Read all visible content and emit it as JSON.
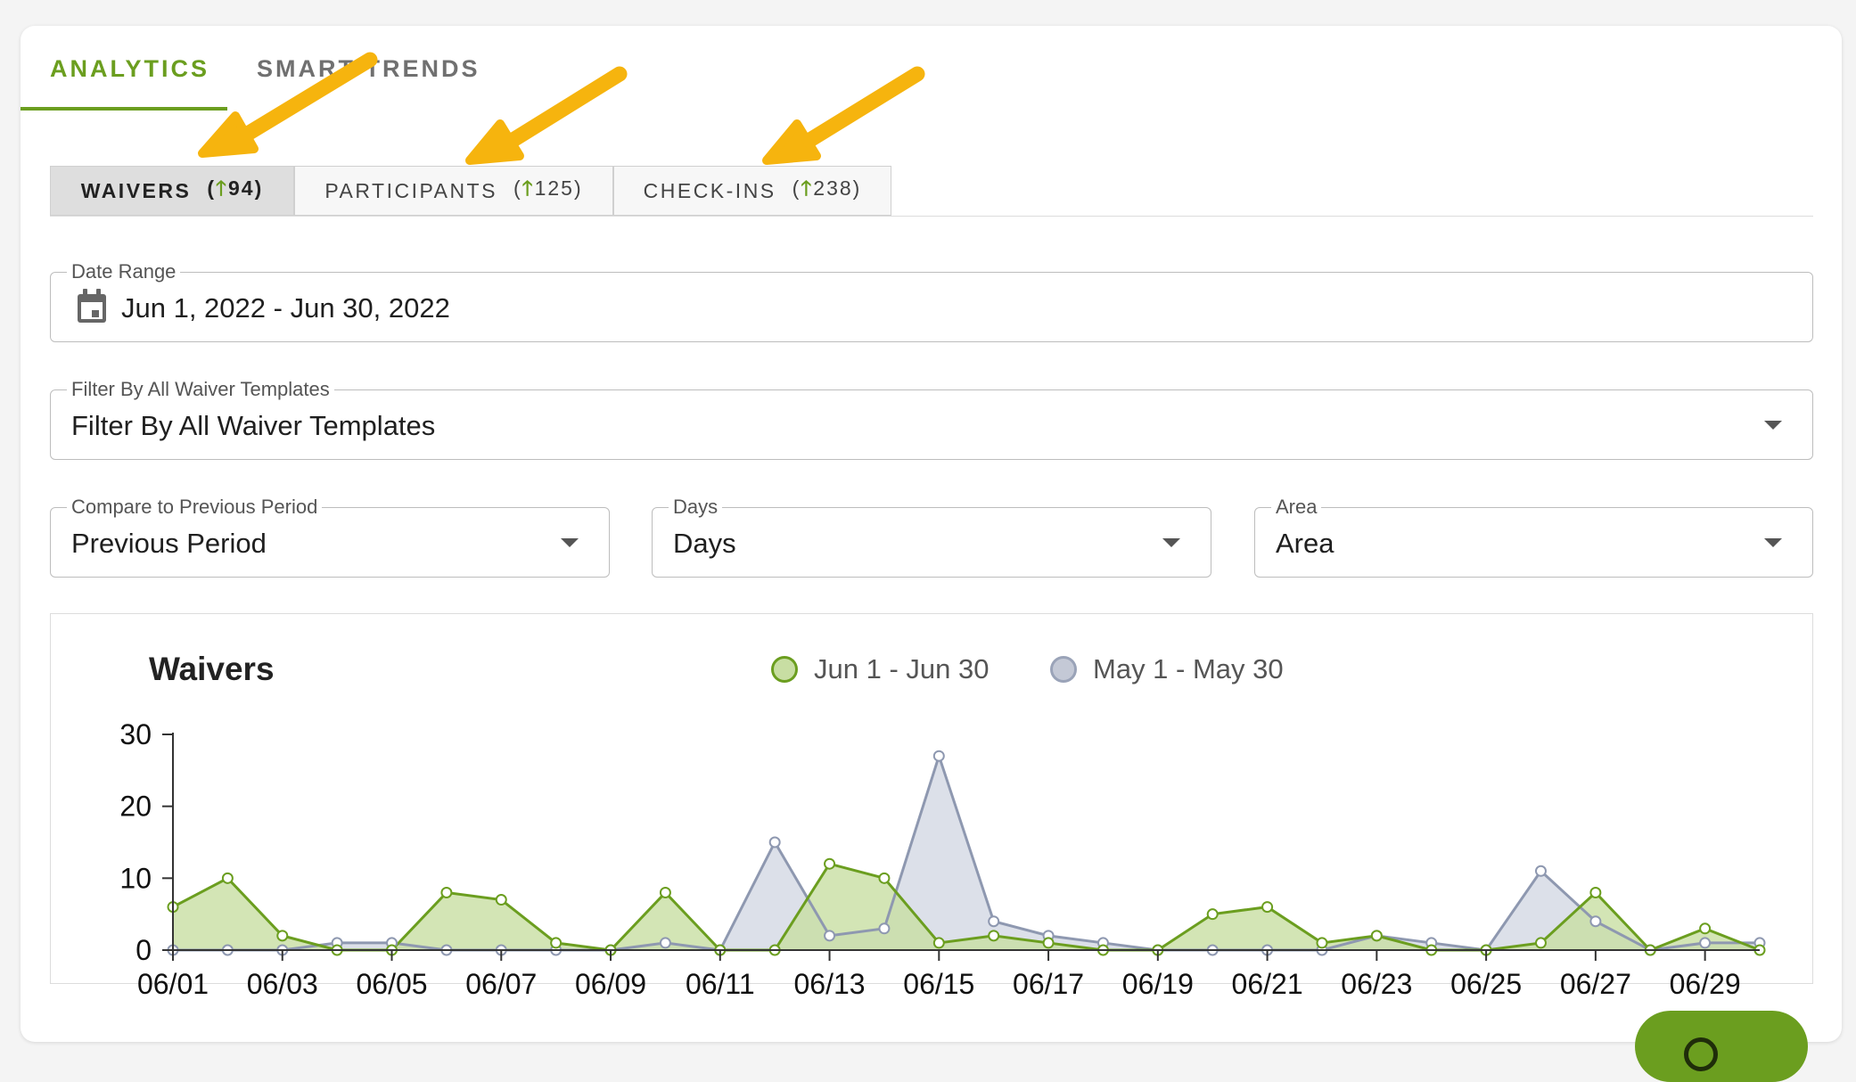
{
  "tabs": [
    {
      "label": "ANALYTICS",
      "active": true
    },
    {
      "label": "SMART TRENDS",
      "active": false
    }
  ],
  "sub_tabs": [
    {
      "label": "WAIVERS",
      "count": "94",
      "active": true
    },
    {
      "label": "PARTICIPANTS",
      "count": "125",
      "active": false
    },
    {
      "label": "CHECK-INS",
      "count": "238",
      "active": false
    }
  ],
  "icons": {
    "trend": "arrow-up-icon",
    "calendar": "calendar-icon",
    "dropdown": "caret-down-icon",
    "help": "help-icon"
  },
  "filters": {
    "date_range": {
      "label": "Date Range",
      "value": "Jun 1, 2022 - Jun 30, 2022"
    },
    "template": {
      "label": "Filter By All Waiver Templates",
      "value": "Filter By All Waiver Templates"
    },
    "compare": {
      "label": "Compare to Previous Period",
      "value": "Previous Period"
    },
    "interval": {
      "label": "Days",
      "value": "Days"
    },
    "chart_type": {
      "label": "Area",
      "value": "Area"
    }
  },
  "colors": {
    "accent": "#6b9e1f",
    "current_fill": "#c8dea3",
    "previous_line": "#8e98b0",
    "previous_fill": "#d3d8e3",
    "annotation_arrow": "#f6b40e"
  },
  "chart_data": {
    "type": "area",
    "title": "Waivers",
    "x": [
      "06/01",
      "06/02",
      "06/03",
      "06/04",
      "06/05",
      "06/06",
      "06/07",
      "06/08",
      "06/09",
      "06/10",
      "06/11",
      "06/12",
      "06/13",
      "06/14",
      "06/15",
      "06/16",
      "06/17",
      "06/18",
      "06/19",
      "06/20",
      "06/21",
      "06/22",
      "06/23",
      "06/24",
      "06/25",
      "06/26",
      "06/27",
      "06/28",
      "06/29",
      "06/30"
    ],
    "x_tick_labels": [
      "06/01",
      "06/03",
      "06/05",
      "06/07",
      "06/09",
      "06/11",
      "06/13",
      "06/15",
      "06/17",
      "06/19",
      "06/21",
      "06/23",
      "06/25",
      "06/27",
      "06/29"
    ],
    "y_ticks": [
      "0",
      "10",
      "20",
      "30"
    ],
    "ylim": [
      0,
      30
    ],
    "legend_position": "top-center",
    "series": [
      {
        "name": "Jun 1 - Jun 30",
        "values": [
          6,
          10,
          2,
          0,
          0,
          8,
          7,
          1,
          0,
          8,
          0,
          0,
          12,
          10,
          1,
          2,
          1,
          0,
          0,
          5,
          6,
          1,
          2,
          0,
          0,
          1,
          8,
          0,
          3,
          0
        ]
      },
      {
        "name": "May 1 - May 30",
        "values": [
          0,
          0,
          0,
          1,
          1,
          0,
          0,
          0,
          0,
          1,
          0,
          15,
          2,
          3,
          27,
          4,
          2,
          1,
          0,
          0,
          0,
          0,
          2,
          1,
          0,
          11,
          4,
          0,
          1,
          1
        ]
      }
    ]
  }
}
